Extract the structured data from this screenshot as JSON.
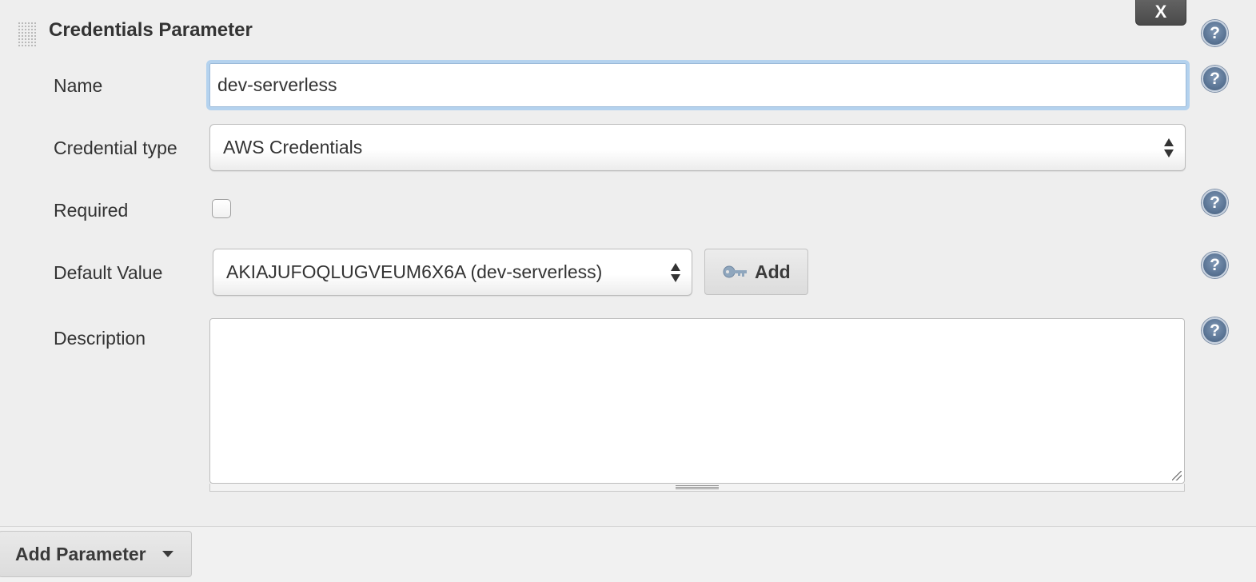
{
  "section": {
    "title": "Credentials Parameter",
    "close_label": "X"
  },
  "help_icon_glyph": "?",
  "fields": {
    "name": {
      "label": "Name",
      "value": "dev-serverless"
    },
    "credential_type": {
      "label": "Credential type",
      "selected": "AWS Credentials"
    },
    "required": {
      "label": "Required",
      "checked": false
    },
    "default_value": {
      "label": "Default Value",
      "selected": "AKIAJUFOQLUGVEUM6X6A (dev-serverless)",
      "add_label": "Add"
    },
    "description": {
      "label": "Description",
      "value": ""
    }
  },
  "footer": {
    "add_parameter_label": "Add Parameter"
  },
  "icons": [
    "drag-handle-icon",
    "close-icon",
    "help-icon",
    "select-arrows-icon",
    "key-icon",
    "resize-handle-icon",
    "caret-down-icon"
  ],
  "colors": {
    "background": "#eeeeee",
    "focus_border": "#b4d2ee",
    "help_icon": "#5b7595",
    "close_button": "#4a4a4a"
  }
}
